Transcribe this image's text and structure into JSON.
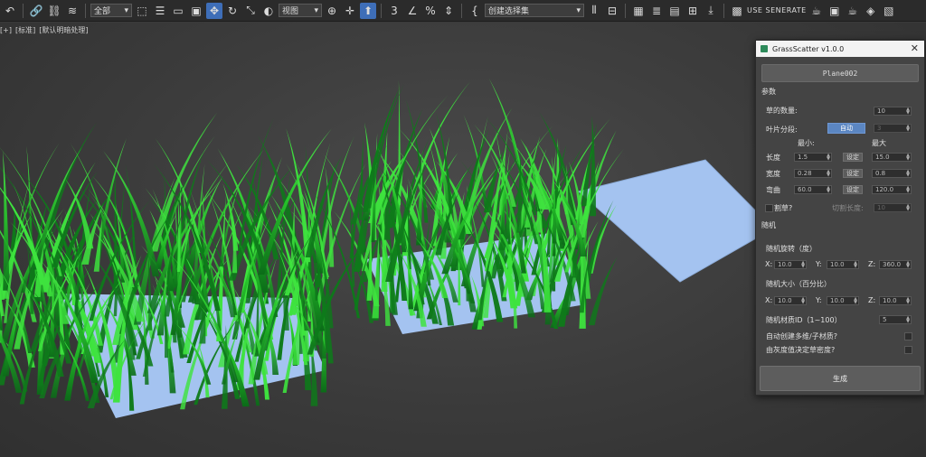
{
  "toolbar": {
    "filter_select": "全部",
    "view_select": "视图",
    "selection_set_select": "创建选择集",
    "right_text": "USE SENERATE"
  },
  "viewport": {
    "label_parts": [
      "[+]",
      "[标准]",
      "[默认明暗处理]"
    ]
  },
  "dialog": {
    "title": "GrassScatter v1.0.0",
    "object_button": "Plane002",
    "section_params": "参数",
    "grass_count_label": "草的数量:",
    "grass_count_value": "10",
    "leaf_segments_label": "叶片分段:",
    "auto_button": "自动",
    "leaf_segments_value": "3",
    "min_header": "最小:",
    "max_header": "最大",
    "rows": [
      {
        "label": "长度",
        "min": "1.5",
        "set": "设定",
        "max": "15.0"
      },
      {
        "label": "宽度",
        "min": "0.28",
        "set": "设定",
        "max": "0.8"
      },
      {
        "label": "弯曲",
        "min": "60.0",
        "set": "设定",
        "max": "120.0"
      }
    ],
    "cut_label": "割草?",
    "cut_length_label": "切割长度:",
    "cut_length_value": "10",
    "section_random": "随机",
    "random_rotation_label": "随机旋转（度）",
    "rot": {
      "x_label": "X:",
      "x": "10.0",
      "y_label": "Y:",
      "y": "10.0",
      "z_label": "Z:",
      "z": "360.0"
    },
    "random_size_label": "随机大小（百分比）",
    "size": {
      "x_label": "X:",
      "x": "10.0",
      "y_label": "Y:",
      "y": "10.0",
      "z_label": "Z:",
      "z": "10.0"
    },
    "random_material_label": "随机材质ID（1~100）",
    "random_material_value": "5",
    "auto_multisub_label": "自动创建多维/子材质?",
    "density_from_gray_label": "由灰度值决定草密度?",
    "generate_button": "生成"
  },
  "colors": {
    "grass_light": "#3ee33e",
    "grass_dark": "#0e7a1a",
    "plane": "#a4c3f0",
    "dialog_bg": "#444444",
    "accent": "#5b86c2"
  }
}
